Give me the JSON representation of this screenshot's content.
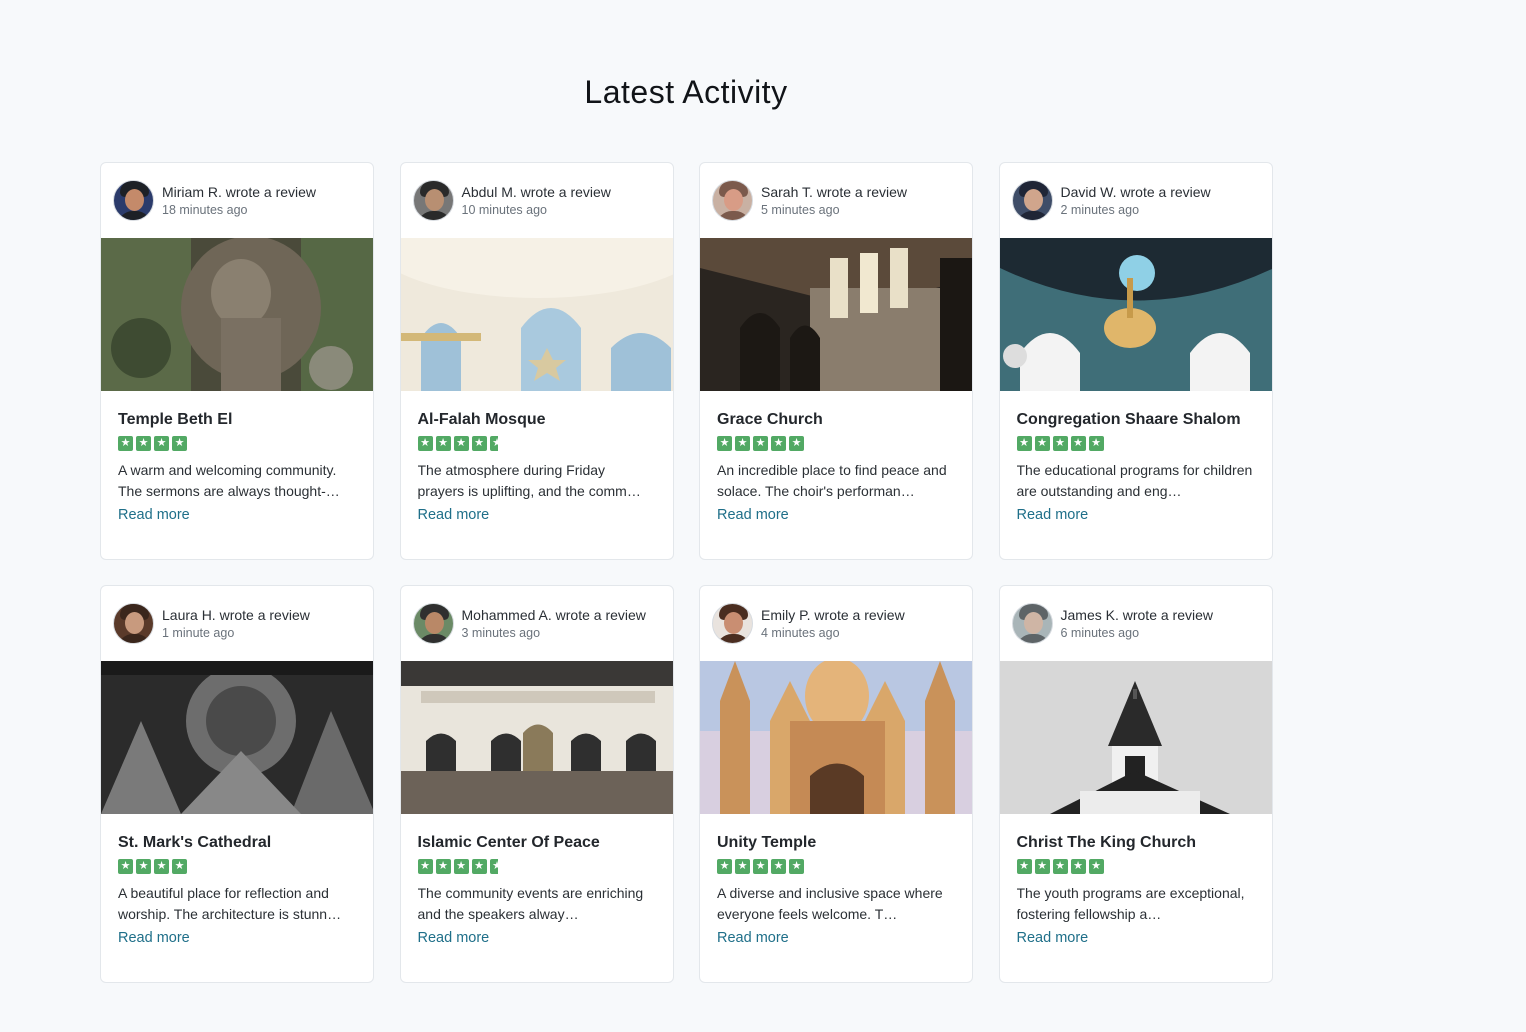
{
  "section_title": "Latest Activity",
  "read_more_label": "Read more",
  "reviews": [
    {
      "reviewer": "Miriam R. wrote a review",
      "time": "18 minutes ago",
      "place": "Temple Beth El",
      "rating": 4,
      "text": "A warm and welcoming community. The sermons are always thought-…",
      "avatar_colors": [
        "#2b3b6b",
        "#c48a6a",
        "#1d2026"
      ],
      "photo_theme": "statue"
    },
    {
      "reviewer": "Abdul M. wrote a review",
      "time": "10 minutes ago",
      "place": "Al-Falah Mosque",
      "rating": 4.5,
      "text": "The atmosphere during Friday prayers is uplifting, and the comm…",
      "avatar_colors": [
        "#777777",
        "#b88f72",
        "#2a2a2a"
      ],
      "photo_theme": "mosque-dome"
    },
    {
      "reviewer": "Sarah T. wrote a review",
      "time": "5 minutes ago",
      "place": "Grace Church",
      "rating": 5,
      "text": "An incredible place to find peace and solace. The choir's performan…",
      "avatar_colors": [
        "#c9b1a3",
        "#d89c86",
        "#7b5a4c"
      ],
      "photo_theme": "cathedral"
    },
    {
      "reviewer": "David W. wrote a review",
      "time": "2 minutes ago",
      "place": "Congregation Shaare Shalom",
      "rating": 5,
      "text": "The educational programs for children are outstanding and eng…",
      "avatar_colors": [
        "#3f4d68",
        "#d0a58c",
        "#1f2536"
      ],
      "photo_theme": "synagogue"
    },
    {
      "reviewer": "Laura H. wrote a review",
      "time": "1 minute ago",
      "place": "St. Mark's Cathedral",
      "rating": 4,
      "text": "A beautiful place for reflection and worship. The architecture is stunn…",
      "avatar_colors": [
        "#5a3a2a",
        "#c89a7e",
        "#3a261c"
      ],
      "photo_theme": "carving"
    },
    {
      "reviewer": "Mohammed A. wrote a review",
      "time": "3 minutes ago",
      "place": "Islamic Center Of Peace",
      "rating": 4.5,
      "text": "The community events are enriching and the speakers alway…",
      "avatar_colors": [
        "#6b8a66",
        "#b98867",
        "#2f2f2f"
      ],
      "photo_theme": "prayer-hall"
    },
    {
      "reviewer": "Emily P. wrote a review",
      "time": "4 minutes ago",
      "place": "Unity Temple",
      "rating": 5,
      "text": "A diverse and inclusive space where everyone feels welcome. T…",
      "avatar_colors": [
        "#e9e3de",
        "#c98e72",
        "#4a2d20"
      ],
      "photo_theme": "hindu-temple"
    },
    {
      "reviewer": "James K. wrote a review",
      "time": "6 minutes ago",
      "place": "Christ The King Church",
      "rating": 5,
      "text": "The youth programs are exceptional, fostering fellowship a…",
      "avatar_colors": [
        "#a9b5b8",
        "#cfb5a5",
        "#5e6467"
      ],
      "photo_theme": "steeple"
    }
  ]
}
